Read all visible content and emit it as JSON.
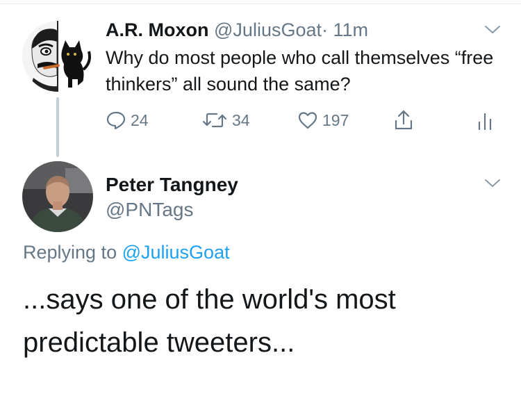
{
  "parent_tweet": {
    "display_name": "A.R. Moxon",
    "handle": "@JuliusGoat",
    "separator": "·",
    "time": "11m",
    "text": "Why do most people who call themselves “free thinkers” all sound the same?",
    "avatar_icon": "man-with-cat-avatar",
    "counts": {
      "replies": "24",
      "retweets": "34",
      "likes": "197"
    },
    "icons": [
      "reply-icon",
      "retweet-icon",
      "like-icon",
      "share-icon",
      "stats-icon",
      "chevron-down-icon"
    ]
  },
  "reply_tweet": {
    "display_name": "Peter Tangney",
    "handle": "@PNTags",
    "replying_label": "Replying to",
    "replying_to": "@JuliusGoat",
    "text": "...says one of the world's most predictable tweeters...",
    "avatar_icon": "man-portrait-avatar"
  },
  "colors": {
    "muted": "#657786",
    "link": "#1da1f2",
    "text": "#14171a",
    "thread_line": "#c4cfd6"
  }
}
